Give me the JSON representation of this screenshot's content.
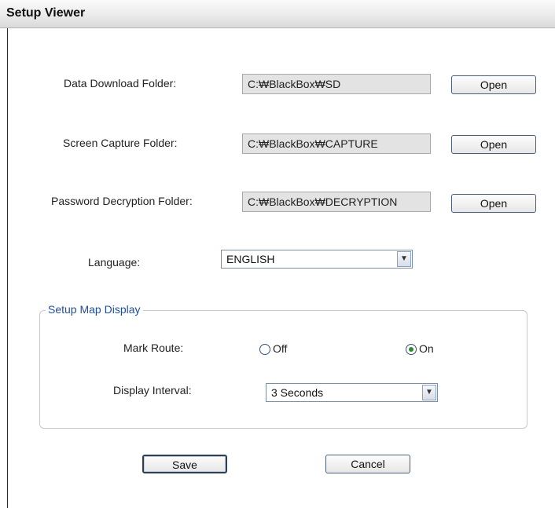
{
  "window": {
    "title": "Setup Viewer"
  },
  "folders": [
    {
      "label": "Data Download Folder:",
      "value": "C:₩BlackBox₩SD",
      "button": "Open"
    },
    {
      "label": "Screen Capture Folder:",
      "value": "C:₩BlackBox₩CAPTURE",
      "button": "Open"
    },
    {
      "label": "Password Decryption Folder:",
      "value": "C:₩BlackBox₩DECRYPTION",
      "button": "Open"
    }
  ],
  "language": {
    "label": "Language:",
    "value": "ENGLISH"
  },
  "map_display": {
    "legend": "Setup Map Display",
    "mark_route": {
      "label": "Mark Route:",
      "off": "Off",
      "on": "On",
      "selected": "on"
    },
    "interval": {
      "label": "Display Interval:",
      "value": "3 Seconds"
    }
  },
  "actions": {
    "save": "Save",
    "cancel": "Cancel"
  },
  "icons": {
    "dropdown": "chevron-down-icon",
    "radio_selected_color": "#2b8a2b"
  }
}
